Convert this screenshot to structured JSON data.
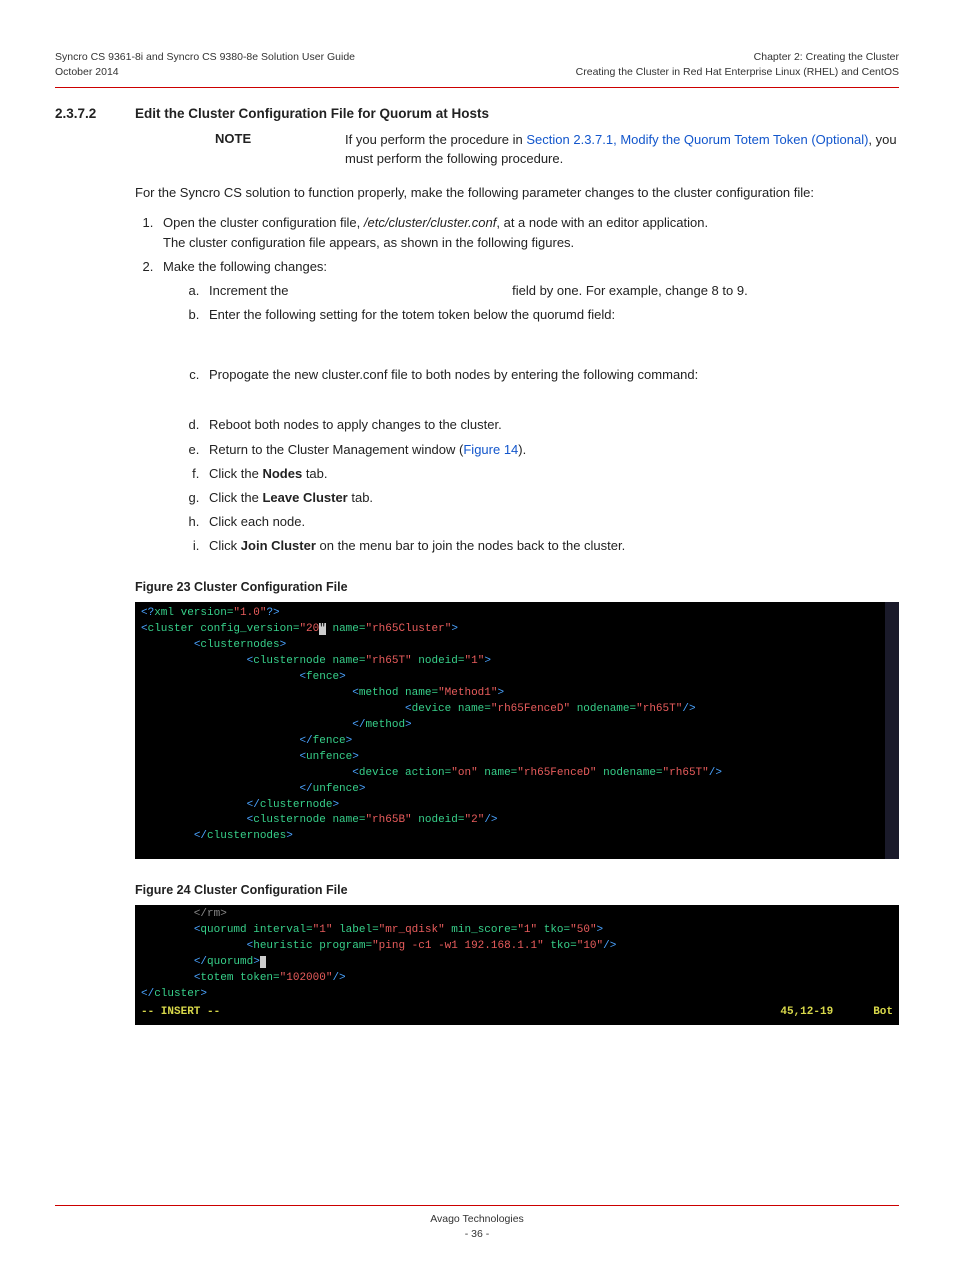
{
  "header": {
    "doc_title": "Syncro CS 9361-8i and Syncro CS 9380-8e Solution User Guide",
    "doc_date": "October 2014",
    "chapter": "Chapter 2: Creating the Cluster",
    "subchapter": "Creating the Cluster in Red Hat Enterprise Linux (RHEL) and CentOS"
  },
  "section": {
    "number": "2.3.7.2",
    "title": "Edit the Cluster Configuration File for Quorum at Hosts"
  },
  "note": {
    "label": "NOTE",
    "pre": "If you perform the procedure in ",
    "link": "Section 2.3.7.1, Modify the Quorum Totem Token (Optional)",
    "post": ", you must perform the following procedure."
  },
  "intro": "For the Syncro CS solution to function properly, make the following parameter changes to the cluster configuration file:",
  "steps": {
    "s1a": "Open the cluster configuration file, ",
    "s1path": "/etc/cluster/cluster.conf",
    "s1b": ", at a node with an editor application.",
    "s1line2": "The cluster configuration file appears, as shown in the following figures.",
    "s2": "Make the following changes:",
    "a_pre": "Increment the ",
    "a_post": "field by one. For example, change 8 to 9.",
    "b": "Enter the following setting for the totem token below the quorumd field:",
    "c": "Propogate the new cluster.conf file to both nodes by entering the following command:",
    "d": "Reboot both nodes to apply changes to the cluster.",
    "e_pre": "Return to the Cluster Management window (",
    "e_link": "Figure 14",
    "e_post": ").",
    "f_pre": "Click the ",
    "f_bold": "Nodes",
    "f_post": " tab.",
    "g_pre": "Click the ",
    "g_bold": "Leave Cluster",
    "g_post": " tab.",
    "h": "Click each node.",
    "i_pre": "Click ",
    "i_bold": "Join Cluster",
    "i_post": " on the menu bar to join the nodes back to the cluster."
  },
  "fig23": {
    "caption": "Figure 23  Cluster Configuration File"
  },
  "fig24": {
    "caption": "Figure 24  Cluster Configuration File",
    "pos": "45,12-19",
    "bot": "Bot",
    "insert": "-- INSERT --"
  },
  "footer": {
    "company": "Avago Technologies",
    "page": "- 36 -"
  },
  "chart_data": {
    "type": "table",
    "note": "XML content shown in terminal screenshots (Figures 23 and 24)",
    "figure23_xml": {
      "declaration": "<?xml version=\"1.0\"?>",
      "cluster": {
        "config_version": "20",
        "name": "rh65Cluster"
      },
      "clusternodes": [
        {
          "name": "rh65T",
          "nodeid": "1",
          "fence": {
            "method": {
              "name": "Method1",
              "device": {
                "name": "rh65FenceD",
                "nodename": "rh65T"
              }
            }
          },
          "unfence": {
            "device": {
              "action": "on",
              "name": "rh65FenceD",
              "nodename": "rh65T"
            }
          }
        },
        {
          "name": "rh65B",
          "nodeid": "2"
        }
      ]
    },
    "figure24_xml": {
      "quorumd": {
        "interval": "1",
        "label": "mr_qdisk",
        "min_score": "1",
        "tko": "50"
      },
      "heuristic": {
        "program": "ping -c1 -w1 192.168.1.1",
        "tko": "10"
      },
      "totem": {
        "token": "102000"
      },
      "vim_mode": "INSERT",
      "vim_pos": "45,12-19",
      "vim_scroll": "Bot"
    }
  }
}
